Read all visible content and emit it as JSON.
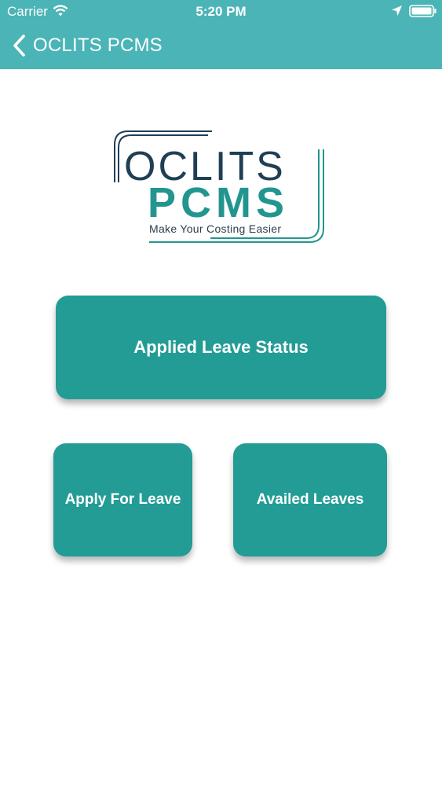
{
  "status_bar": {
    "carrier": "Carrier",
    "time": "5:20 PM",
    "icons": [
      "wifi-icon",
      "location-icon",
      "battery-icon"
    ]
  },
  "nav": {
    "back_icon": "chevron-left-icon",
    "title": "OCLITS PCMS"
  },
  "logo": {
    "line1": "OCLITS",
    "line2": "PCMS",
    "tagline": "Make Your Costing Easier"
  },
  "tiles": {
    "applied_leave_status": "Applied Leave Status",
    "apply_for_leave": "Apply For Leave",
    "availed_leaves": "Availed Leaves"
  },
  "colors": {
    "header": "#4bb4b6",
    "tile": "#239c96",
    "logo_dark": "#1f3f55",
    "logo_teal": "#23958f",
    "background": "#ffffff"
  }
}
